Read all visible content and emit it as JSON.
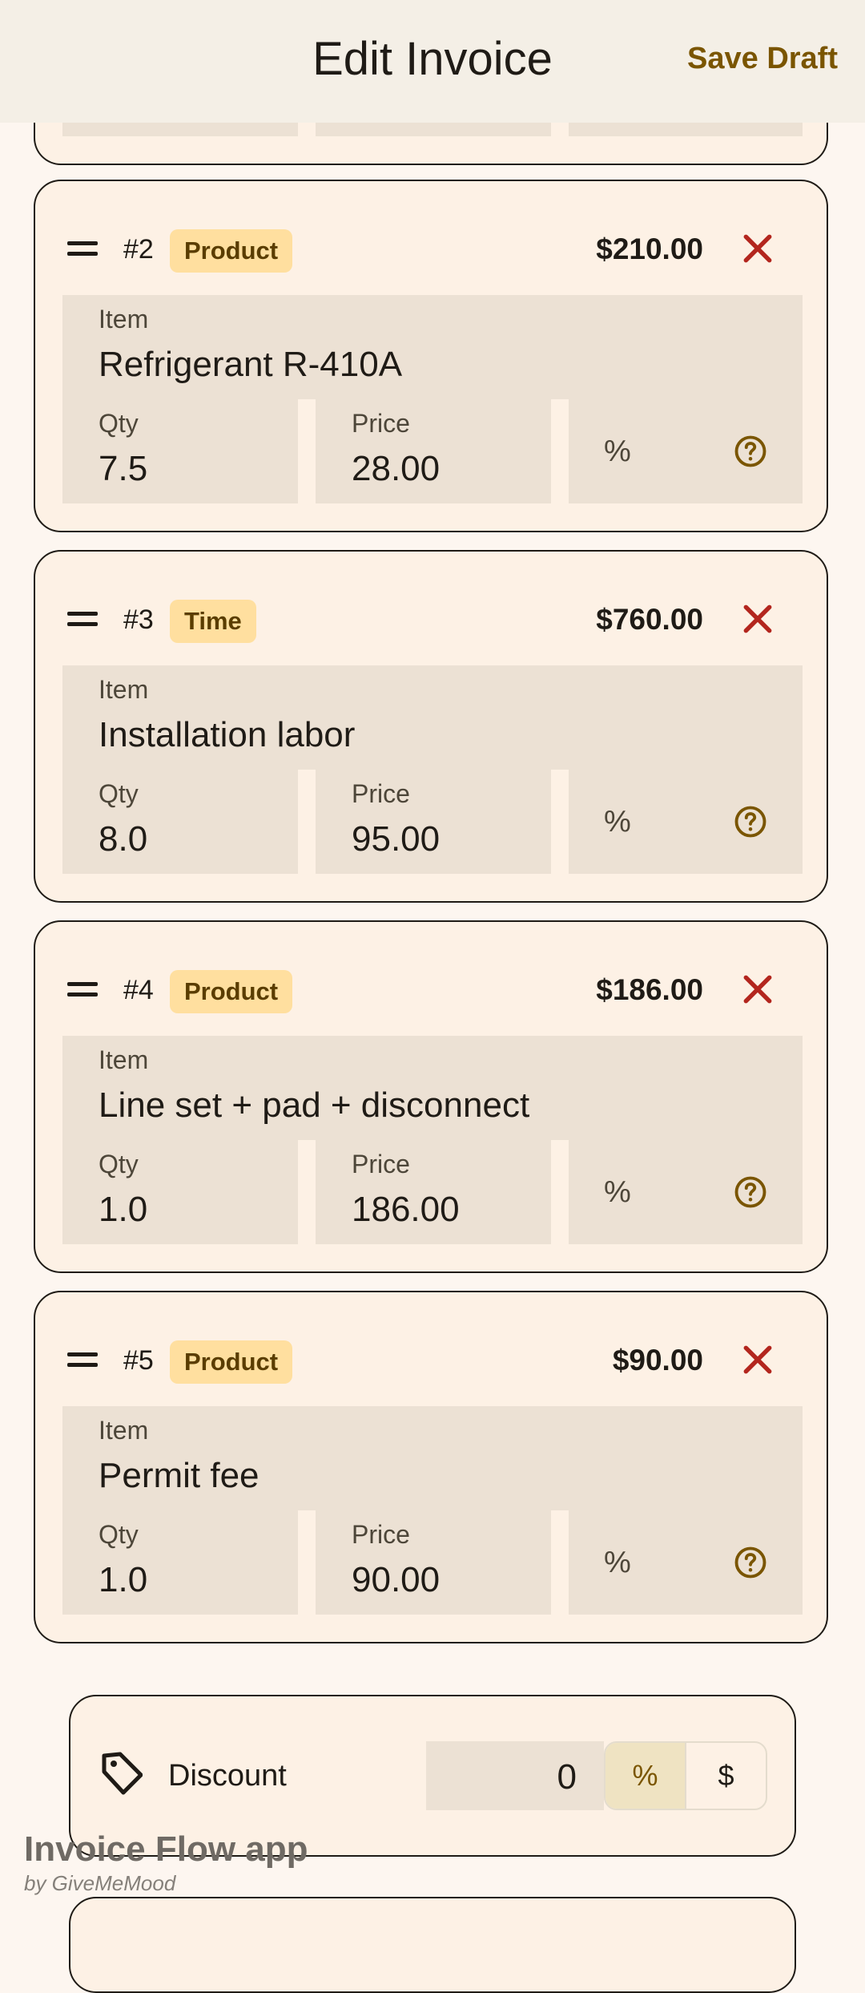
{
  "header": {
    "title": "Edit Invoice",
    "save_label": "Save Draft"
  },
  "labels": {
    "item": "Item",
    "qty": "Qty",
    "price": "Price",
    "percent": "%"
  },
  "line_items": [
    {
      "number": "#2",
      "type": "Product",
      "total": "$210.00",
      "item": "Refrigerant R-410A",
      "qty": "7.5",
      "price": "28.00"
    },
    {
      "number": "#3",
      "type": "Time",
      "total": "$760.00",
      "item": "Installation labor",
      "qty": "8.0",
      "price": "95.00"
    },
    {
      "number": "#4",
      "type": "Product",
      "total": "$186.00",
      "item": "Line set + pad + disconnect",
      "qty": "1.0",
      "price": "186.00"
    },
    {
      "number": "#5",
      "type": "Product",
      "total": "$90.00",
      "item": "Permit fee",
      "qty": "1.0",
      "price": "90.00"
    }
  ],
  "discount": {
    "label": "Discount",
    "value": "0",
    "percent_option": "%",
    "dollar_option": "$",
    "selected": "%"
  },
  "brand": {
    "name": "Invoice Flow app",
    "by": "by GiveMeMood"
  },
  "colors": {
    "accent": "#7a5500",
    "delete": "#b3261e",
    "badge": "#ffdf9f",
    "card": "#fdf1e5",
    "field": "#ece1d4"
  }
}
